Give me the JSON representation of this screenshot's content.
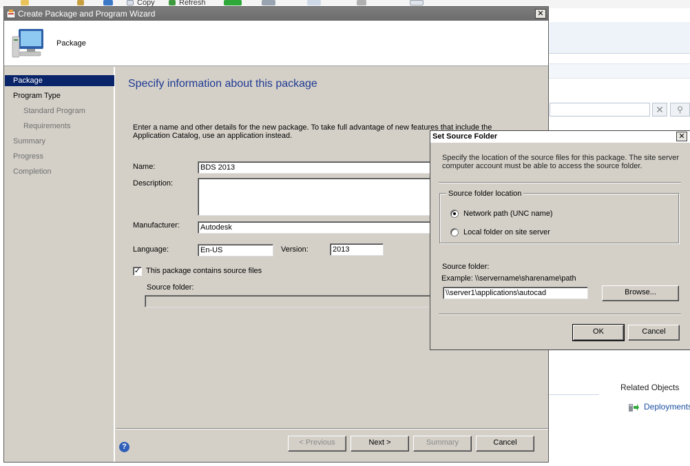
{
  "background": {
    "ribbon": {
      "copy_label": "Copy",
      "refresh_label": "Refresh"
    },
    "related_objects_title": "Related Objects",
    "deployments_link": "Deployments"
  },
  "wizard": {
    "title": "Create Package and Program Wizard",
    "header_label": "Package",
    "nav": [
      {
        "label": "Package",
        "state": "active"
      },
      {
        "label": "Program Type",
        "state": "enabled"
      },
      {
        "label": "Standard Program",
        "state": "dim"
      },
      {
        "label": "Requirements",
        "state": "dim"
      },
      {
        "label": "Summary",
        "state": "dim"
      },
      {
        "label": "Progress",
        "state": "dim"
      },
      {
        "label": "Completion",
        "state": "dim"
      }
    ],
    "heading": "Specify information about this package",
    "intro": "Enter a name and other details for the new package. To take full advantage of new features that include the Application Catalog, use an application instead.",
    "fields": {
      "name_label": "Name:",
      "name_value": "BDS 2013",
      "description_label": "Description:",
      "description_value": "",
      "manufacturer_label": "Manufacturer:",
      "manufacturer_value": "Autodesk",
      "language_label": "Language:",
      "language_value": "En-US",
      "version_label": "Version:",
      "version_value": "2013",
      "source_files_checkbox": "This package contains source files",
      "source_files_checked": true,
      "source_folder_label": "Source folder:",
      "source_folder_value": ""
    },
    "buttons": {
      "previous": "< Previous",
      "next": "Next >",
      "summary": "Summary",
      "cancel": "Cancel"
    },
    "help_icon": "?"
  },
  "dialog": {
    "title": "Set Source Folder",
    "description": "Specify the location of the source files for this package. The site server computer account must be able to access the source folder.",
    "group_label": "Source folder location",
    "radio_network": "Network path (UNC name)",
    "radio_local": "Local folder on site server",
    "selected_option": "network",
    "source_folder_label": "Source folder:",
    "example": "Example: \\\\servername\\sharename\\path",
    "source_folder_value": "\\\\server1\\applications\\autocad",
    "browse": "Browse...",
    "ok": "OK",
    "cancel": "Cancel"
  },
  "colors": {
    "nav_active": "#0a246a",
    "heading": "#1f3a93",
    "window_face": "#d4d0c8",
    "link": "#1a4ea0"
  }
}
